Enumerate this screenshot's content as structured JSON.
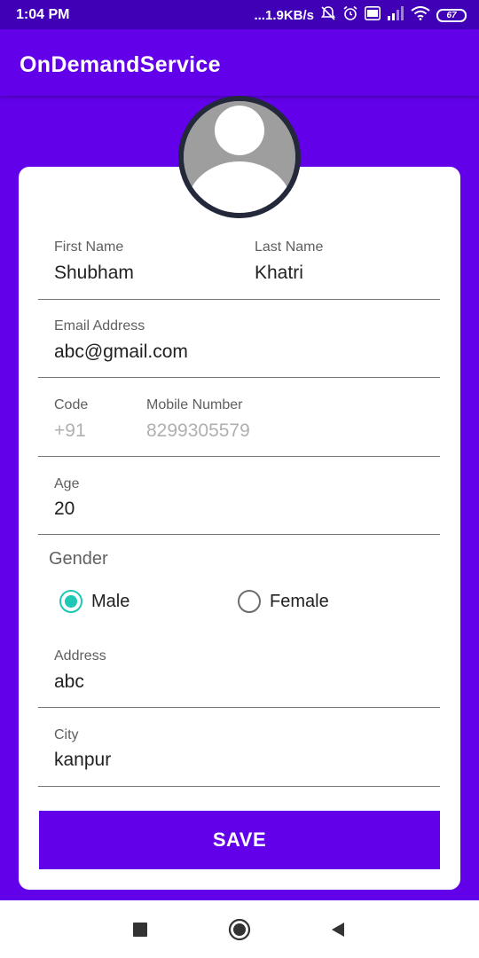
{
  "status_bar": {
    "time": "1:04 PM",
    "network_speed": "...1.9KB/s",
    "battery": "67",
    "icons": [
      "mute-alarm-icon",
      "alarm-icon",
      "volte-icon",
      "signal-icon",
      "wifi-icon",
      "battery-icon"
    ]
  },
  "app_bar": {
    "title": "OnDemandService"
  },
  "profile": {
    "avatar_icon": "person-avatar-icon"
  },
  "form": {
    "first_name": {
      "label": "First Name",
      "value": "Shubham"
    },
    "last_name": {
      "label": "Last Name",
      "value": "Khatri"
    },
    "email": {
      "label": "Email Address",
      "value": "abc@gmail.com"
    },
    "code": {
      "label": "Code",
      "value": "+91"
    },
    "mobile": {
      "label": "Mobile Number",
      "value": "8299305579"
    },
    "age": {
      "label": "Age",
      "value": "20"
    },
    "gender": {
      "label": "Gender",
      "options": [
        {
          "label": "Male",
          "checked": true
        },
        {
          "label": "Female",
          "checked": false
        }
      ]
    },
    "address": {
      "label": "Address",
      "value": "abc"
    },
    "city": {
      "label": "City",
      "value": "kanpur"
    },
    "save_label": "SAVE"
  },
  "colors": {
    "primary": "#6200EA",
    "status_bar": "#3F00B6",
    "accent": "#1EC8B4"
  },
  "nav_bar": {
    "icons": [
      "recents-square-icon",
      "home-circle-icon",
      "back-triangle-icon"
    ]
  }
}
